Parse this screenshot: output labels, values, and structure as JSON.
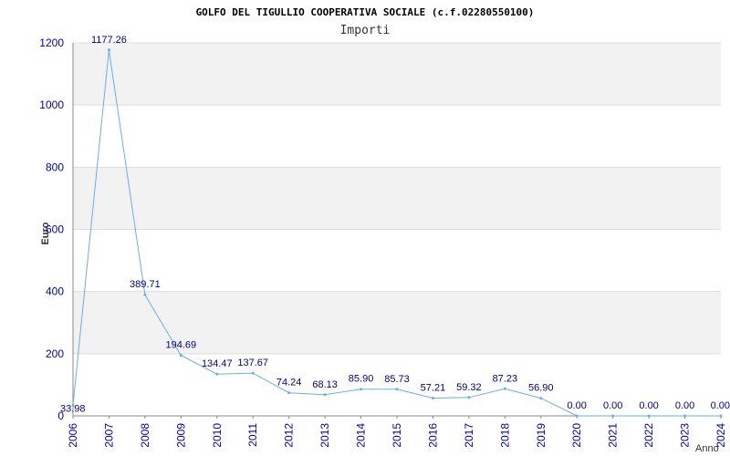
{
  "chart_data": {
    "type": "line",
    "title": "GOLFO DEL TIGULLIO COOPERATIVA SOCIALE (c.f.02280550100)",
    "subtitle": "Importi",
    "ylabel": "Euro",
    "xlabel": "Anno",
    "ylim": [
      0,
      1200
    ],
    "yticks": [
      0,
      200,
      400,
      600,
      800,
      1000,
      1200
    ],
    "ytick_labels": [
      "0",
      "200",
      "400",
      "600",
      "800",
      "1000",
      "1200"
    ],
    "grid": "horizontal bands",
    "x": [
      "2006",
      "2007",
      "2008",
      "2009",
      "2010",
      "2011",
      "2012",
      "2013",
      "2014",
      "2015",
      "2016",
      "2017",
      "2018",
      "2019",
      "2020",
      "2021",
      "2022",
      "2023",
      "2024"
    ],
    "series": [
      {
        "values": [
          33.98,
          1177.26,
          389.71,
          194.69,
          134.47,
          137.67,
          74.24,
          68.13,
          85.9,
          85.73,
          57.21,
          59.32,
          87.23,
          56.9,
          0.0,
          0.0,
          0.0,
          0.0,
          0.0
        ],
        "labels": [
          "33.98",
          "1177.26",
          "389.71",
          "194.69",
          "134.47",
          "137.67",
          "74.24",
          "68.13",
          "85.90",
          "85.73",
          "57.21",
          "59.32",
          "87.23",
          "56.90",
          "0.00",
          "0.00",
          "0.00",
          "0.00",
          "0.00"
        ],
        "color": "#6aaee8"
      }
    ],
    "colors": {
      "band": "#f2f2f2",
      "grid": "#dddddd",
      "axis": "#888888",
      "tick": "#0000aa",
      "data_label": "#000080"
    }
  }
}
